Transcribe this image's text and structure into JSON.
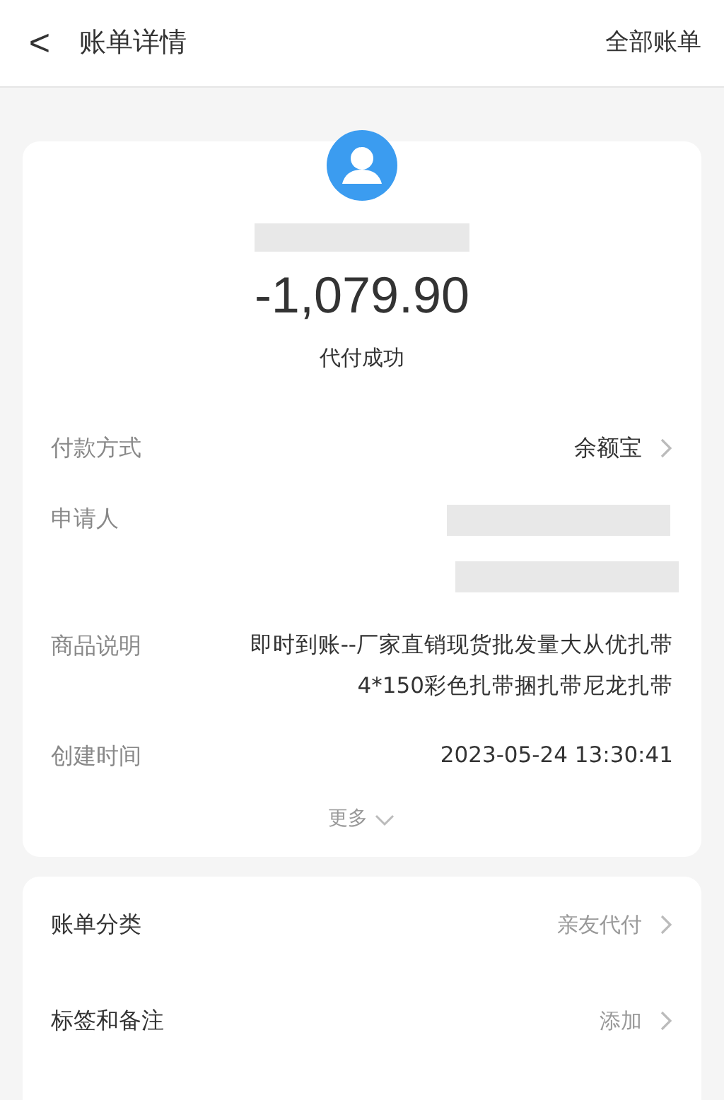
{
  "header": {
    "back": "<",
    "title": "账单详情",
    "action": "全部账单"
  },
  "summary": {
    "amount": "-1,079.90",
    "status": "代付成功"
  },
  "details": [
    {
      "kind": "link",
      "label": "付款方式",
      "value": "余额宝"
    },
    {
      "kind": "redacted",
      "label": "申请人"
    },
    {
      "kind": "text",
      "label": "商品说明",
      "lines": [
        "即时到账--厂家直销现货批发量大从优扎带",
        "4*150彩色扎带捆扎带尼龙扎带"
      ]
    },
    {
      "kind": "text",
      "label": "创建时间",
      "lines": [
        "2023-05-24 13:30:41"
      ]
    }
  ],
  "more": "更多",
  "extra": [
    {
      "label": "账单分类",
      "value": "亲友代付"
    },
    {
      "label": "标签和备注",
      "value": "添加"
    }
  ]
}
